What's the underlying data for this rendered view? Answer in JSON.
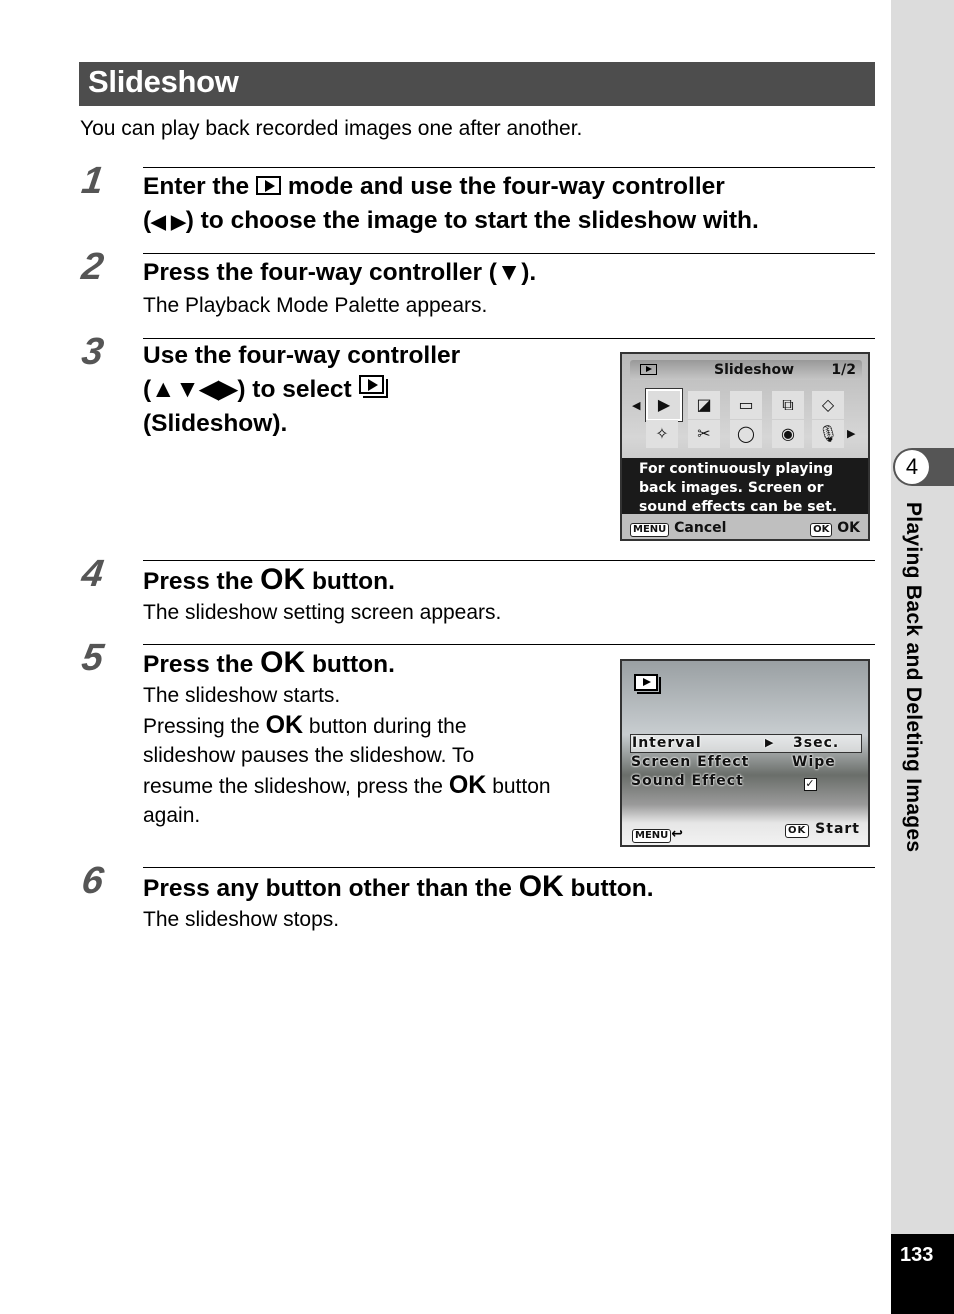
{
  "section_title": "Slideshow",
  "intro": "You can play back recorded images one after another.",
  "steps": [
    {
      "num": "1",
      "title_parts": [
        "Enter the",
        "mode and use the four-way controller",
        "(",
        ") to choose the image to start the slideshow with."
      ],
      "arrows": "◀ ▶"
    },
    {
      "num": "2",
      "title": "Press the four-way controller (▼).",
      "body": "The Playback Mode Palette appears."
    },
    {
      "num": "3",
      "title_line1": "Use the four-way controller",
      "title_line2_pre": "(▲▼◀▶) to select",
      "title_line3": "(Slideshow)."
    },
    {
      "num": "4",
      "title_pre": "Press the",
      "ok": "OK",
      "title_post": "button.",
      "body": "The slideshow setting screen appears."
    },
    {
      "num": "5",
      "title_pre": "Press the",
      "ok": "OK",
      "title_post": "button.",
      "body_lines": [
        "The slideshow starts.",
        "Pressing the",
        "button during the",
        "slideshow pauses the slideshow. To",
        "resume the slideshow, press the",
        "button",
        "again."
      ]
    },
    {
      "num": "6",
      "title_pre": "Press any button other than the",
      "ok": "OK",
      "title_post": "button.",
      "body": "The slideshow stops."
    }
  ],
  "screen_palette": {
    "header_title": "Slideshow",
    "page": "1/2",
    "icons": [
      "slideshow-icon",
      "resize-icon",
      "cropping-icon",
      "image-copy-icon",
      "rotate-icon",
      "digital-filter-icon",
      "frame-composite-icon",
      "frame-icon",
      "red-eye-icon",
      "voice-memo-icon"
    ],
    "description": [
      "For continuously playing",
      "back images. Screen or",
      "sound effects can be set."
    ],
    "cancel_key": "MENU",
    "cancel_label": "Cancel",
    "ok_key": "OK",
    "ok_label": "OK"
  },
  "screen_settings": {
    "rows": [
      {
        "label": "Interval",
        "value": "3sec.",
        "selected": true
      },
      {
        "label": "Screen Effect",
        "value": "Wipe"
      },
      {
        "label": "Sound Effect",
        "value": "☑"
      }
    ],
    "back_key": "MENU",
    "back_symbol": "↩",
    "start_key": "OK",
    "start_label": "Start"
  },
  "sidebar": {
    "chapter_number": "4",
    "chapter_title": "Playing Back and Deleting Images",
    "page_number": "133"
  }
}
